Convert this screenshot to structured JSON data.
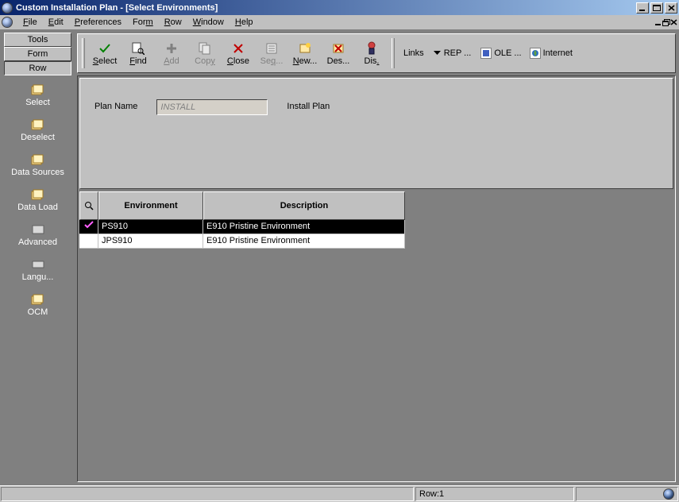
{
  "window": {
    "title": "Custom Installation Plan - [Select Environments]"
  },
  "menus": [
    "File",
    "Edit",
    "Preferences",
    "Form",
    "Row",
    "Window",
    "Help"
  ],
  "toolbar": {
    "select": "Select",
    "find": "Find",
    "add": "Add",
    "copy": "Copy",
    "close": "Close",
    "seq": "Seq...",
    "new": "New...",
    "des": "Des...",
    "dis": "Dis.",
    "links_label": "Links",
    "dropdown": "REP ...",
    "ole": "OLE ...",
    "internet": "Internet"
  },
  "sidebar": {
    "tabs": {
      "tools": "Tools",
      "form": "Form",
      "row": "Row"
    },
    "items": [
      {
        "label": "Select"
      },
      {
        "label": "Deselect"
      },
      {
        "label": "Data Sources"
      },
      {
        "label": "Data Load"
      },
      {
        "label": "Advanced"
      },
      {
        "label": "Langu..."
      },
      {
        "label": "OCM"
      }
    ]
  },
  "form": {
    "plan_name_label": "Plan Name",
    "plan_name_value": "INSTALL",
    "install_plan_label": "Install Plan"
  },
  "grid": {
    "headers": {
      "environment": "Environment",
      "description": "Description"
    },
    "rows": [
      {
        "selected": true,
        "environment": "PS910",
        "description": "E910 Pristine Environment"
      },
      {
        "selected": false,
        "environment": "JPS910",
        "description": "E910 Pristine Environment"
      }
    ]
  },
  "status": {
    "row": "Row:1"
  }
}
